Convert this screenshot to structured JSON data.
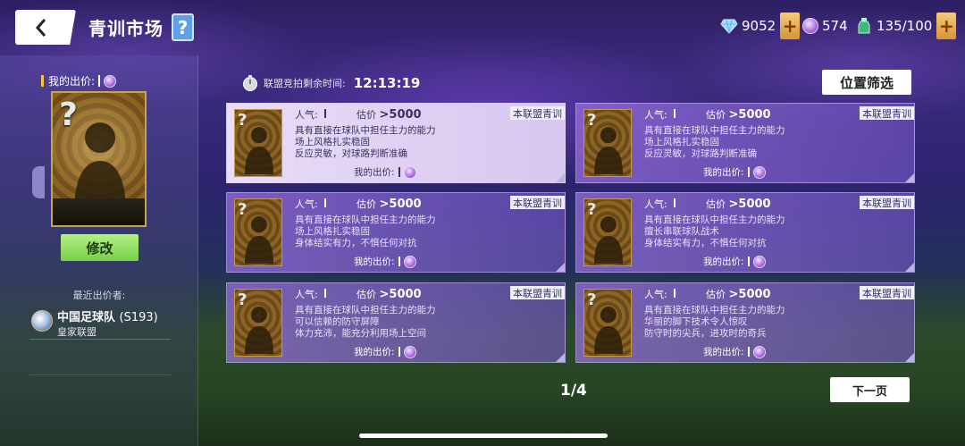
{
  "header": {
    "title": "青训市场",
    "help_label": "?",
    "resources": [
      {
        "icon": "diamond-icon",
        "value": "9052",
        "has_plus": true
      },
      {
        "icon": "purple-coin-icon",
        "value": "574",
        "has_plus": false
      },
      {
        "icon": "energy-bottle-icon",
        "value": "135/100",
        "has_plus": true
      }
    ],
    "plus_label": "+"
  },
  "left": {
    "my_bid_label": "我的出价:",
    "card_placeholder": "?",
    "modify_label": "修改",
    "recent_bidder_label": "最近出价者:",
    "bidder": {
      "name": "中国足球队",
      "server": "(S193)",
      "league": "皇家联盟"
    }
  },
  "main": {
    "timer_label": "联盟竞拍剩余时间:",
    "timer_value": "12:13:19",
    "filter_label": "位置筛选",
    "page_indicator": "1/4",
    "next_label": "下一页",
    "card_labels": {
      "popularity": "人气:",
      "estimate": "估价",
      "tag": "本联盟青训",
      "my_bid": "我的出价:",
      "placeholder": "?"
    },
    "cards": [
      {
        "estimate": ">5000",
        "selected": true,
        "lines": [
          "具有直接在球队中担任主力的能力",
          "场上风格扎实稳固",
          "反应灵敏，对球路判断准确"
        ]
      },
      {
        "estimate": ">5000",
        "selected": false,
        "lines": [
          "具有直接在球队中担任主力的能力",
          "场上风格扎实稳固",
          "反应灵敏，对球路判断准确"
        ]
      },
      {
        "estimate": ">5000",
        "selected": false,
        "lines": [
          "具有直接在球队中担任主力的能力",
          "场上风格扎实稳固",
          "身体结实有力，不惧任何对抗"
        ]
      },
      {
        "estimate": ">5000",
        "selected": false,
        "lines": [
          "具有直接在球队中担任主力的能力",
          "擅长串联球队战术",
          "身体结实有力，不惧任何对抗"
        ]
      },
      {
        "estimate": ">5000",
        "selected": false,
        "lines": [
          "具有直接在球队中担任主力的能力",
          "可以信赖的防守屏障",
          "体力充沛，能充分利用场上空间"
        ]
      },
      {
        "estimate": ">5000",
        "selected": false,
        "lines": [
          "具有直接在球队中担任主力的能力",
          "华丽的脚下技术令人惊叹",
          "防守时的尖兵，进攻时的奇兵"
        ]
      }
    ]
  }
}
